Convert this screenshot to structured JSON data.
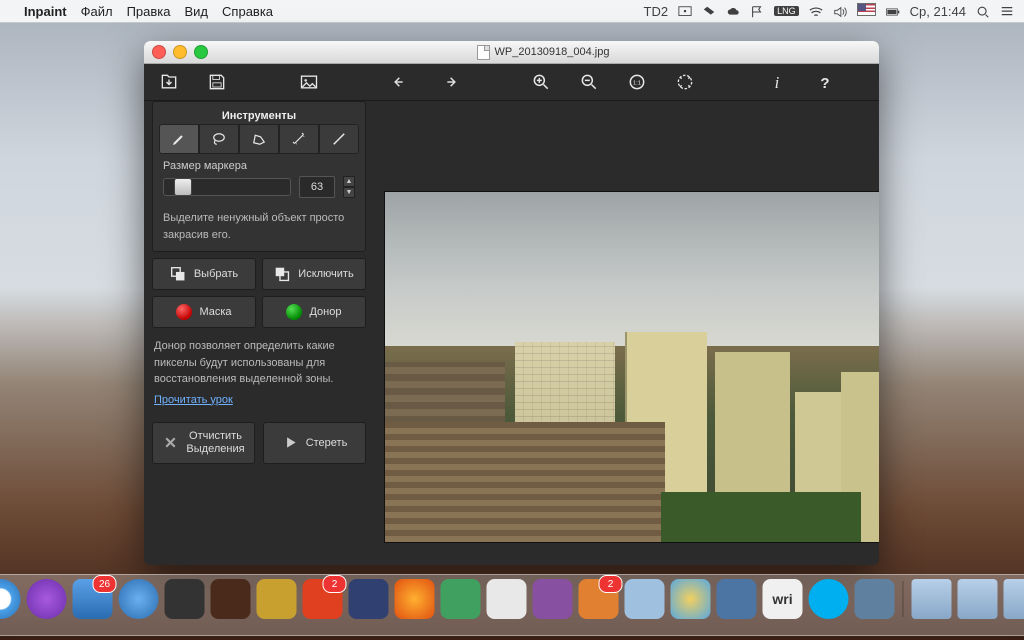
{
  "menubar": {
    "app": "Inpaint",
    "items": [
      "Файл",
      "Правка",
      "Вид",
      "Справка"
    ],
    "right": {
      "td": "D2",
      "clock": "Ср, 21:44"
    }
  },
  "window": {
    "title": "WP_20130918_004.jpg"
  },
  "toolbar": {
    "open": "open",
    "save": "save",
    "image": "image",
    "undo": "undo",
    "redo": "redo",
    "zoom_in": "zoom-in",
    "zoom_out": "zoom-out",
    "zoom_1_1": "1:1",
    "zoom_fit": "fit",
    "info": "info",
    "help": "help"
  },
  "sidebar": {
    "tools_title": "Инструменты",
    "marker_label": "Размер маркера",
    "marker_value": "63",
    "hint1": "Выделите ненужный объект просто закрасив его.",
    "select_label": "Выбрать",
    "exclude_label": "Исключить",
    "mask_label": "Маска",
    "donor_label": "Донор",
    "donor_desc": "Донор позволяет определить какие пикселы будут использованы для восстановления выделенной зоны.",
    "tutorial": "Прочитать урок",
    "clear_line1": "Отчистить",
    "clear_line2": "Выделения",
    "erase": "Стереть"
  },
  "dock": {
    "badges": {
      "mail": "26",
      "todoist": "2",
      "books": "2"
    },
    "writer_label": "wri"
  }
}
